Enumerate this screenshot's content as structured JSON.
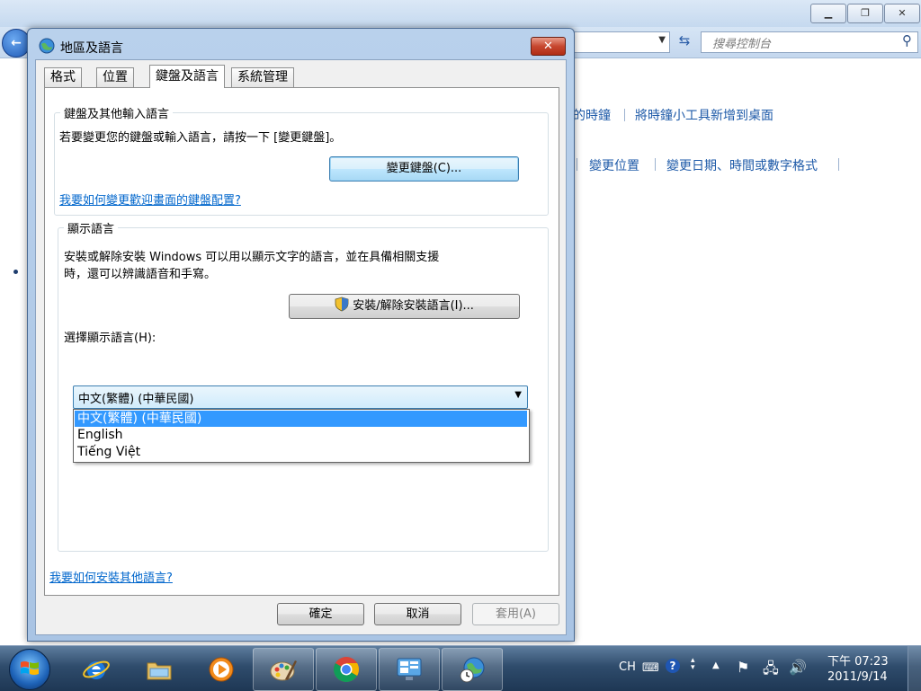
{
  "background_window": {
    "search_placeholder": "搜尋控制台",
    "links_row1": [
      "的時鐘",
      "將時鐘小工具新增到桌面"
    ],
    "links_row2": [
      "變更位置",
      "變更日期、時間或數字格式"
    ]
  },
  "dialog": {
    "title": "地區及語言",
    "close_label": "✕",
    "tabs": [
      {
        "label": "格式",
        "active": false
      },
      {
        "label": "位置",
        "active": false
      },
      {
        "label": "鍵盤及語言",
        "active": true
      },
      {
        "label": "系統管理",
        "active": false
      }
    ],
    "keyboard_group": {
      "title": "鍵盤及其他輸入語言",
      "description": "若要變更您的鍵盤或輸入語言，請按一下 [變更鍵盤]。",
      "change_button": "變更鍵盤(C)...",
      "help_link": "我要如何變更歡迎畫面的鍵盤配置?"
    },
    "display_group": {
      "title": "顯示語言",
      "description_line1": "安裝或解除安裝 Windows 可以用以顯示文字的語言，並在具備相關支援",
      "description_line2": "時，還可以辨識語音和手寫。",
      "install_button": "安裝/解除安裝語言(I)...",
      "select_label": "選擇顯示語言(H):",
      "selected_value": "中文(繁體) (中華民國)",
      "options": [
        "中文(繁體) (中華民國)",
        "English",
        "Tiếng Việt"
      ],
      "highlighted_index": 0
    },
    "bottom_link": "我要如何安裝其他語言?",
    "buttons": {
      "ok": "確定",
      "cancel": "取消",
      "apply": "套用(A)"
    }
  },
  "taskbar": {
    "apps": [
      {
        "name": "Internet Explorer",
        "icon": "ie-icon",
        "active": false
      },
      {
        "name": "Windows Explorer",
        "icon": "folder-icon",
        "active": false
      },
      {
        "name": "Windows Media Player",
        "icon": "media-player-icon",
        "active": false
      },
      {
        "name": "Paint",
        "icon": "paint-icon",
        "active": true
      },
      {
        "name": "Google Chrome",
        "icon": "chrome-icon",
        "active": true
      },
      {
        "name": "Control Panel",
        "icon": "control-panel-icon",
        "active": true
      },
      {
        "name": "Region and Language",
        "icon": "globe-clock-icon",
        "active": true
      }
    ],
    "tray": {
      "language": "CH",
      "time": "下午 07:23",
      "date": "2011/9/14"
    }
  },
  "colors": {
    "link": "#0066cc",
    "selection": "#3399ff",
    "dialog_frame": "#b9d1ec",
    "taskbar": "#2f4c6c"
  }
}
